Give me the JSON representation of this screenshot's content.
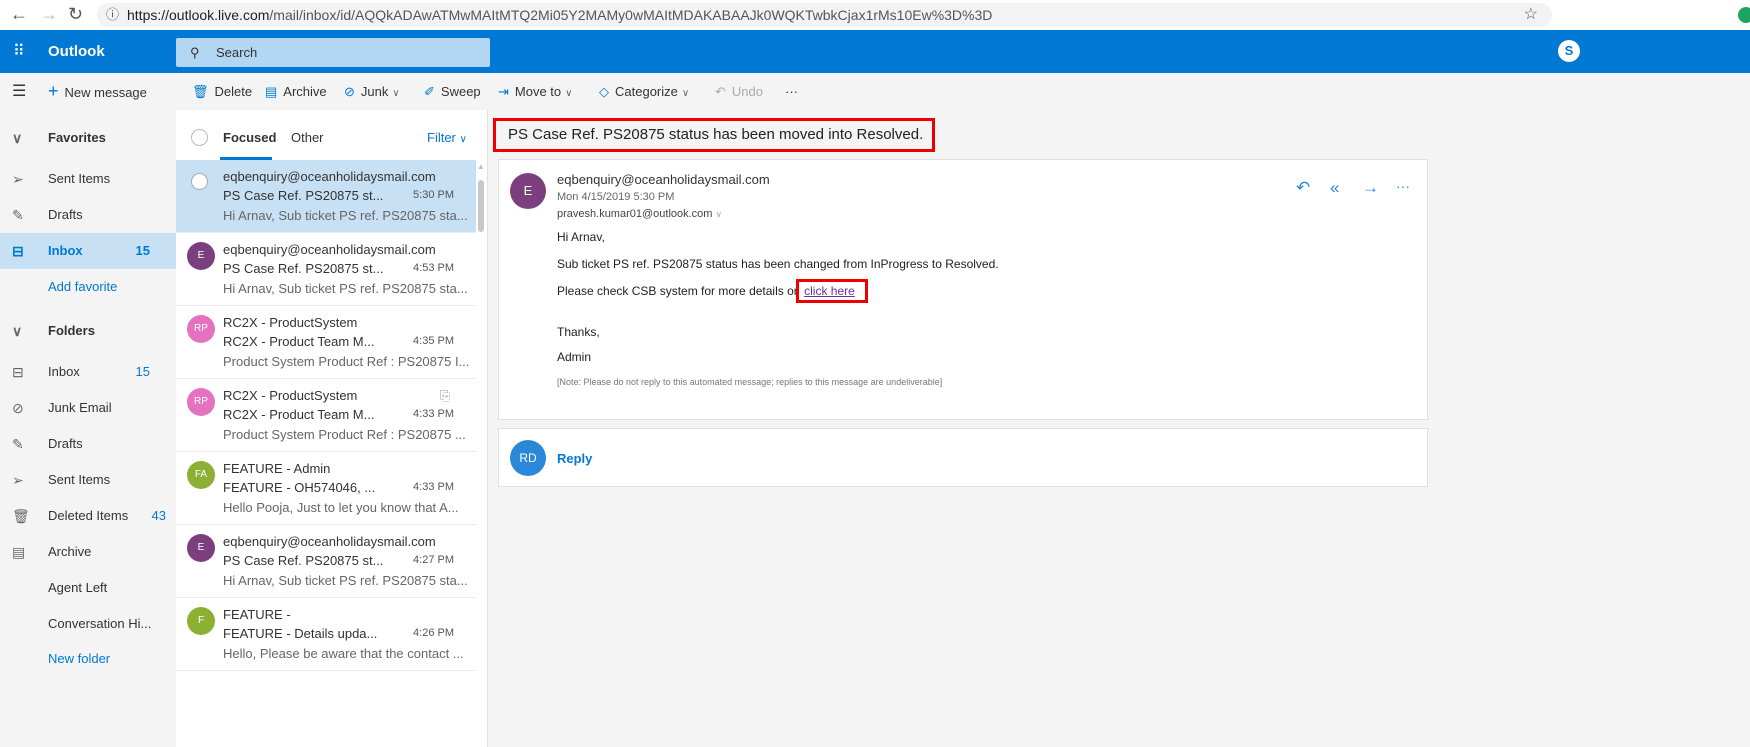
{
  "browser": {
    "url_host": "https://outlook.live.com",
    "url_path": "/mail/inbox/id/AQQkADAwATMwMAItMTQ2Mi05Y2MAMy0wMAItMDAKABAAJk0WQKTwbkCjax1rMs10Ew%3D%3D"
  },
  "header": {
    "app_name": "Outlook",
    "search_placeholder": "Search"
  },
  "toolbar": {
    "new_message": "New message",
    "delete": "Delete",
    "archive": "Archive",
    "junk": "Junk",
    "sweep": "Sweep",
    "move_to": "Move to",
    "categorize": "Categorize",
    "undo": "Undo",
    "more": "···"
  },
  "sidebar": {
    "favorites": "Favorites",
    "fav_items": [
      {
        "label": "Sent Items"
      },
      {
        "label": "Drafts"
      },
      {
        "label": "Inbox",
        "count": "15"
      }
    ],
    "add_favorite": "Add favorite",
    "folders": "Folders",
    "folder_items": [
      {
        "label": "Inbox",
        "count": "15"
      },
      {
        "label": "Junk Email"
      },
      {
        "label": "Drafts"
      },
      {
        "label": "Sent Items"
      },
      {
        "label": "Deleted Items",
        "count": "43"
      },
      {
        "label": "Archive"
      },
      {
        "label": "Agent Left"
      },
      {
        "label": "Conversation Hi..."
      }
    ],
    "new_folder": "New folder"
  },
  "list": {
    "tab_focused": "Focused",
    "tab_other": "Other",
    "filter": "Filter",
    "items": [
      {
        "initials": "",
        "color": "#7b3f7e",
        "from": "eqbenquiry@oceanholidaysmail.com",
        "subject": "PS Case Ref. PS20875 st...",
        "time": "5:30 PM",
        "preview": "Hi Arnav, Sub ticket PS ref. PS20875 sta..."
      },
      {
        "initials": "E",
        "color": "#7b3f7e",
        "from": "eqbenquiry@oceanholidaysmail.com",
        "subject": "PS Case Ref. PS20875 st...",
        "time": "4:53 PM",
        "preview": "Hi Arnav, Sub ticket PS ref. PS20875 sta..."
      },
      {
        "initials": "RP",
        "color": "#e372c0",
        "from": "RC2X - ProductSystem",
        "subject": "RC2X - Product Team M...",
        "time": "4:35 PM",
        "preview": "Product System Product Ref : PS20875 I..."
      },
      {
        "initials": "RP",
        "color": "#e372c0",
        "from": "RC2X - ProductSystem",
        "subject": "RC2X - Product Team M...",
        "time": "4:33 PM",
        "preview": "Product System Product Ref : PS20875 ..."
      },
      {
        "initials": "FA",
        "color": "#8cb034",
        "from": "FEATURE - Admin",
        "subject": "FEATURE - OH574046, ...",
        "time": "4:33 PM",
        "preview": "Hello Pooja, Just to let you know that A..."
      },
      {
        "initials": "E",
        "color": "#7b3f7e",
        "from": "eqbenquiry@oceanholidaysmail.com",
        "subject": "PS Case Ref. PS20875 st...",
        "time": "4:27 PM",
        "preview": "Hi Arnav, Sub ticket PS ref. PS20875 sta..."
      },
      {
        "initials": "F",
        "color": "#8cb034",
        "from": "FEATURE -",
        "subject": "FEATURE - Details upda...",
        "time": "4:26 PM",
        "preview": "Hello, Please be aware that the contact ..."
      }
    ]
  },
  "message": {
    "subject": "PS Case Ref. PS20875 status has been moved into Resolved.",
    "avatar": "E",
    "from": "eqbenquiry@oceanholidaysmail.com",
    "date": "Mon 4/15/2019 5:30 PM",
    "to": "pravesh.kumar01@outlook.com",
    "greeting": "Hi Arnav,",
    "line1": "Sub ticket PS ref. PS20875 status has been changed from InProgress to Resolved.",
    "line2": "Please check CSB system for more details or",
    "link": "click here",
    "thanks": "Thanks,",
    "sign": "Admin",
    "note": "[Note: Please do not reply to this automated message; replies to this message are undeliverable]"
  },
  "reply": {
    "avatar": "RD",
    "label": "Reply"
  }
}
